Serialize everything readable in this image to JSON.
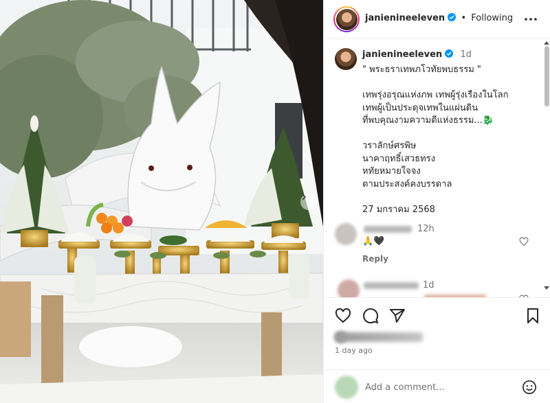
{
  "header": {
    "username": "janienineeleven",
    "follow_status": "Following",
    "separator": "•"
  },
  "caption": {
    "username": "janienineeleven",
    "time": "1d",
    "lines": [
      "\" พระธราเทพภโวทัยพบธรรม \"",
      "",
      "เทพรุ่งอรุณแห่งภพ เทพผู้รุ่งเรืองในโลก",
      "เทพผู้เป็นประดุจเทพในแผ่นดิน",
      "ที่พบคุณงามความดีแห่งธรรม...🐉",
      "",
      "วราลักษ์ศรพิษ",
      "นาคาฤทธิ์เสวธทรง",
      "หทัยหมายใจจง",
      "ตามประสงค์คงบรรดาล",
      "",
      "27 มกราคม 2568"
    ]
  },
  "comments": [
    {
      "time": "12h",
      "text": "🙏🖤",
      "reply_label": "Reply"
    },
    {
      "time": "1d"
    }
  ],
  "footer": {
    "time_ago": "1 day ago",
    "comment_placeholder": "Add a comment..."
  },
  "icons": {
    "verified": "verified-badge-icon",
    "more": "more-options-icon",
    "like": "heart-icon",
    "comment": "comment-icon",
    "share": "share-icon",
    "save": "bookmark-icon",
    "emoji": "emoji-icon",
    "next": "chevron-right-icon"
  },
  "colors": {
    "verified_blue": "#0095f6",
    "muted_text": "#737373",
    "border": "#efefef"
  }
}
